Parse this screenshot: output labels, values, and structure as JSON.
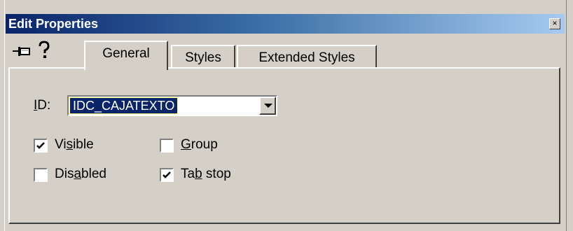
{
  "window": {
    "title": "Edit Properties",
    "close_glyph": "×"
  },
  "toolbar": {
    "pin_icon": "pushpin-icon",
    "help_icon": "help-icon"
  },
  "tabs": [
    {
      "label": "General",
      "selected": true
    },
    {
      "label": "Styles",
      "selected": false
    },
    {
      "label": "Extended Styles",
      "selected": false
    }
  ],
  "general": {
    "id_label_prefix": "",
    "id_label_accel": "I",
    "id_label_rest": "D:",
    "id_value": "IDC_CAJATEXTO",
    "checkboxes": [
      {
        "label_pre": "Vi",
        "label_accel": "s",
        "label_post": "ible",
        "checked": true
      },
      {
        "label_pre": "",
        "label_accel": "G",
        "label_post": "roup",
        "checked": false
      },
      {
        "label_pre": "Dis",
        "label_accel": "a",
        "label_post": "bled",
        "checked": false
      },
      {
        "label_pre": "Ta",
        "label_accel": "b",
        "label_post": " stop",
        "checked": true
      }
    ]
  },
  "colors": {
    "titlebar_start": "#0a246a",
    "titlebar_end": "#a6caf0",
    "face": "#d4d0c8",
    "selection": "#0a246a"
  }
}
